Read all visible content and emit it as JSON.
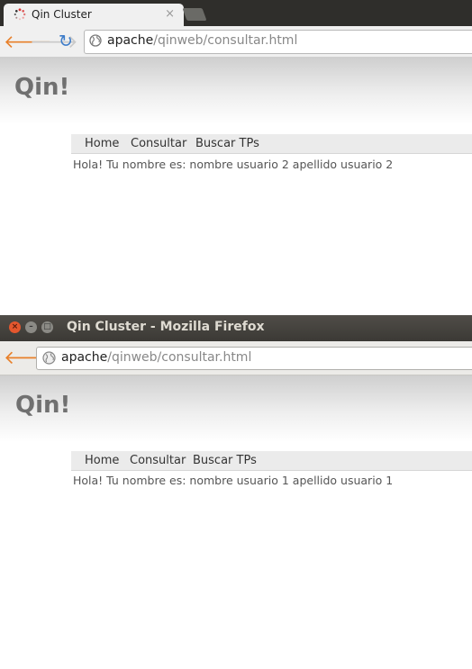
{
  "chrome_window": {
    "tab_title": "Qin Cluster",
    "tab_close": "×",
    "back_glyph": "🡐",
    "forward_glyph": "🡒",
    "reload_glyph": "↻",
    "address_host": "apache",
    "address_path": "/qinweb/consultar.html",
    "page": {
      "site_title": "Qin!",
      "menu": [
        "Home",
        "Consultar",
        "Buscar TPs"
      ],
      "greeting": "Hola! Tu nombre es: nombre usuario 2 apellido usuario 2"
    }
  },
  "firefox_window": {
    "window_title": "Qin Cluster - Mozilla Firefox",
    "close_glyph": "×",
    "minimize_glyph": "–",
    "maximize_glyph": "□",
    "back_glyph": "🡐",
    "address_host": "apache",
    "address_path": "/qinweb/consultar.html",
    "page": {
      "site_title": "Qin!",
      "menu": [
        "Home",
        "Consultar",
        "Buscar TPs"
      ],
      "greeting": "Hola! Tu nombre es: nombre usuario 1 apellido usuario 1"
    }
  },
  "colors": {
    "back_arrow": "#e8802a",
    "reload": "#3d7cc9",
    "title_text": "#707070"
  },
  "icons": {
    "tab_favicon": "loading-spinner-icon",
    "omnibox": "globe-icon",
    "urlbar": "globe-icon"
  }
}
